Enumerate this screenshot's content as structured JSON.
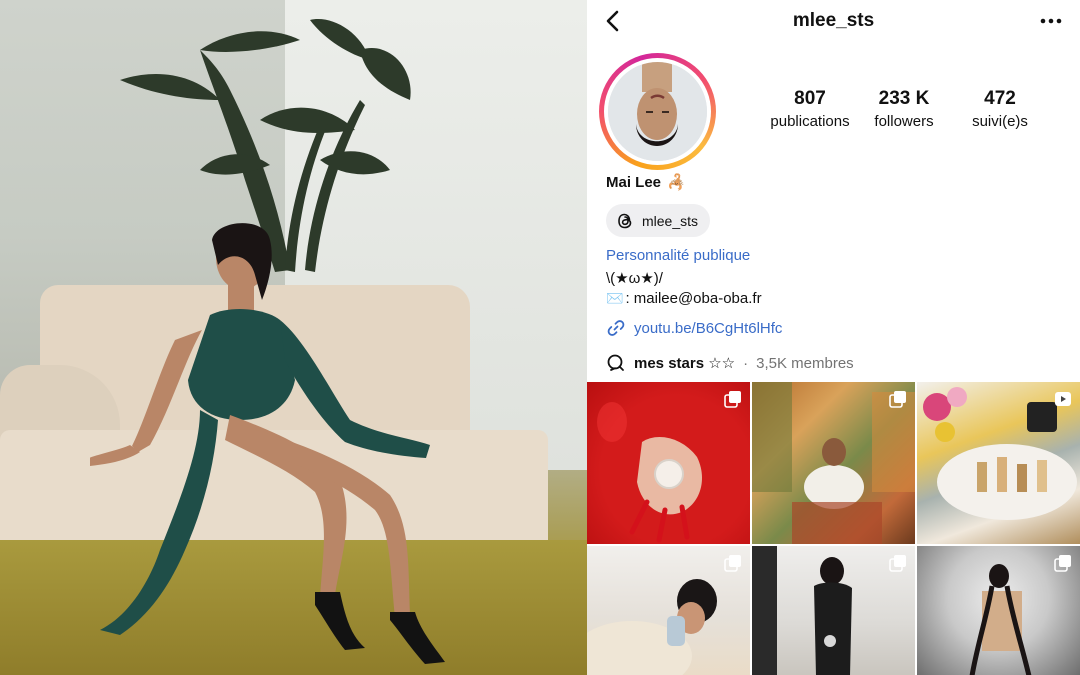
{
  "profile": {
    "username": "mlee_sts",
    "display_name": "Mai Lee",
    "name_emoji": "🦂",
    "stats": {
      "posts_count": "807",
      "posts_label": "publications",
      "followers_count": "233 K",
      "followers_label": "followers",
      "following_count": "472",
      "following_label": "suivi(e)s"
    },
    "threads_handle": "mlee_sts",
    "category": "Personnalité publique",
    "bio_line1": "\\(★ω★)/",
    "bio_email_prefix": "✉️",
    "bio_line2": ": mailee@oba-oba.fr",
    "link": "youtu.be/B6CgHt6lHfc",
    "channel_name": "mes stars ☆☆",
    "channel_separator": "·",
    "channel_meta": "3,5K membres"
  },
  "icons": {
    "back": "chevron-left-icon",
    "more": "more-horizontal-icon",
    "threads": "threads-icon",
    "link": "link-icon",
    "channel": "broadcast-channel-icon",
    "carousel": "carousel-icon",
    "reel": "reel-icon"
  },
  "grid": [
    {
      "type": "carousel"
    },
    {
      "type": "carousel"
    },
    {
      "type": "reel"
    },
    {
      "type": "carousel"
    },
    {
      "type": "carousel"
    },
    {
      "type": "carousel"
    }
  ],
  "colors": {
    "link_blue": "#3a6cc8",
    "story_ring_start": "#f9a11b",
    "story_ring_end": "#d3279a",
    "meta_gray": "#737373"
  }
}
